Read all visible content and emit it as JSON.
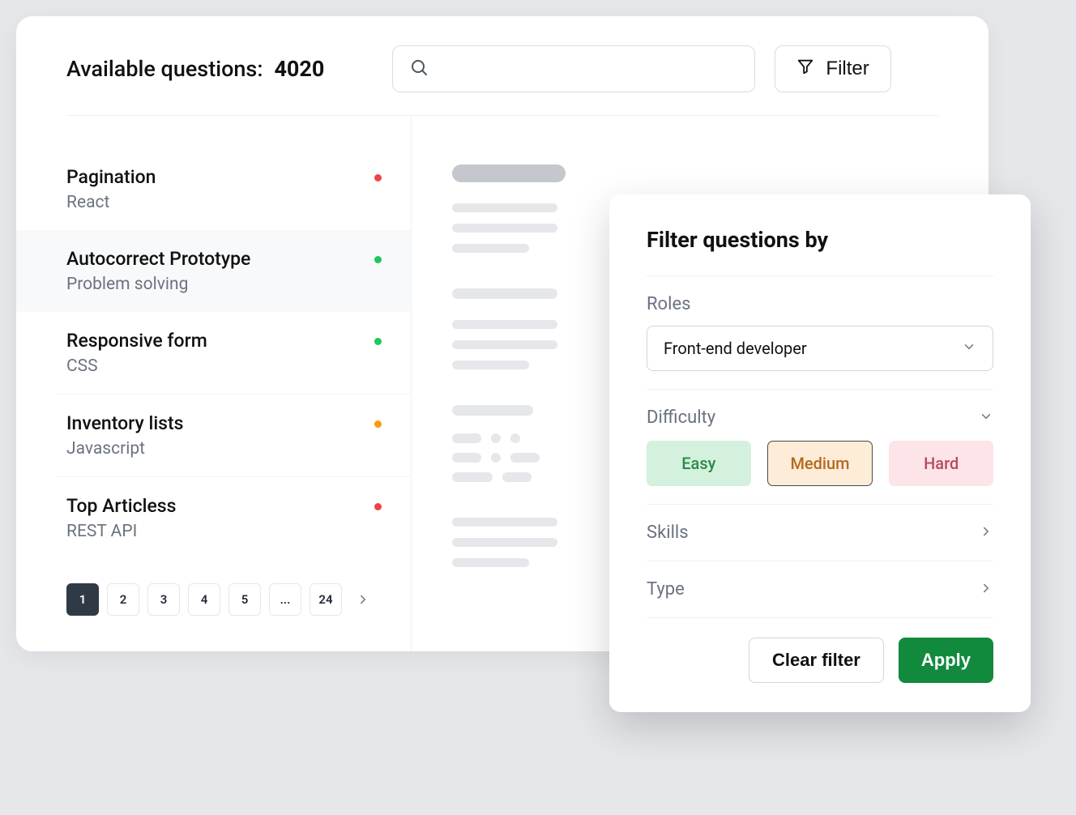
{
  "header": {
    "title_label": "Available questions:",
    "count": "4020",
    "search_placeholder": "",
    "filter_label": "Filter"
  },
  "questions": [
    {
      "title": "Pagination",
      "tag": "React",
      "dot": "red",
      "selected": false
    },
    {
      "title": "Autocorrect Prototype",
      "tag": "Problem solving",
      "dot": "green",
      "selected": true
    },
    {
      "title": "Responsive form",
      "tag": "CSS",
      "dot": "green",
      "selected": false
    },
    {
      "title": "Inventory lists",
      "tag": "Javascript",
      "dot": "orange",
      "selected": false
    },
    {
      "title": "Top Articless",
      "tag": "REST API",
      "dot": "red",
      "selected": false
    }
  ],
  "pagination": {
    "pages": [
      "1",
      "2",
      "3",
      "4",
      "5",
      "...",
      "24"
    ],
    "active": "1"
  },
  "filter_panel": {
    "title": "Filter questions by",
    "roles_label": "Roles",
    "roles_value": "Front-end developer",
    "difficulty_label": "Difficulty",
    "difficulty_options": {
      "easy": "Easy",
      "medium": "Medium",
      "hard": "Hard"
    },
    "skills_label": "Skills",
    "type_label": "Type",
    "clear_label": "Clear filter",
    "apply_label": "Apply"
  }
}
